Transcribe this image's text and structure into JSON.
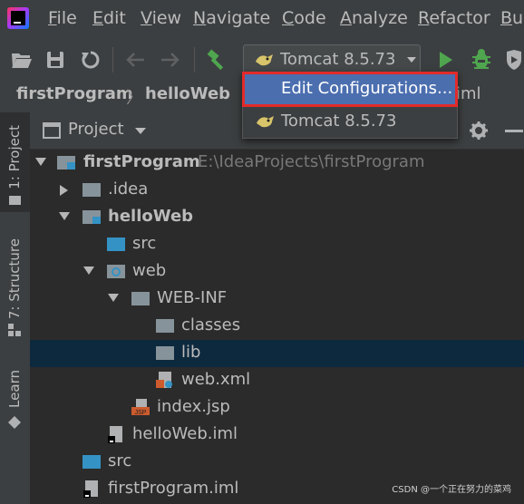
{
  "menu": [
    "File",
    "Edit",
    "View",
    "Navigate",
    "Code",
    "Analyze",
    "Refactor",
    "Buil"
  ],
  "toolbar": {
    "run_config": "Tomcat 8.5.73"
  },
  "breadcrumb": [
    "firstProgram",
    "helloWeb",
    "iml"
  ],
  "dropdown": {
    "items": [
      "Edit Configurations...",
      "Tomcat 8.5.73"
    ]
  },
  "sidebar": {
    "tabs": [
      "1: Project",
      "7: Structure",
      "Learn"
    ]
  },
  "panel": {
    "title": "Project"
  },
  "tree": [
    {
      "name": "firstProgram",
      "path": "E:\\IdeaProjects\\firstProgram"
    },
    {
      "name": ".idea"
    },
    {
      "name": "helloWeb"
    },
    {
      "name": "src"
    },
    {
      "name": "web"
    },
    {
      "name": "WEB-INF"
    },
    {
      "name": "classes"
    },
    {
      "name": "lib"
    },
    {
      "name": "web.xml"
    },
    {
      "name": "index.jsp"
    },
    {
      "name": "helloWeb.iml"
    },
    {
      "name": "src"
    },
    {
      "name": "firstProgram.iml"
    }
  ],
  "watermark": "CSDN @一个正在努力的菜鸡",
  "colors": {
    "accent_selection": "#4b6eaf",
    "highlight_box": "#e22a2a",
    "tree_selected": "#0d293e",
    "run_green": "#4fa64f"
  }
}
